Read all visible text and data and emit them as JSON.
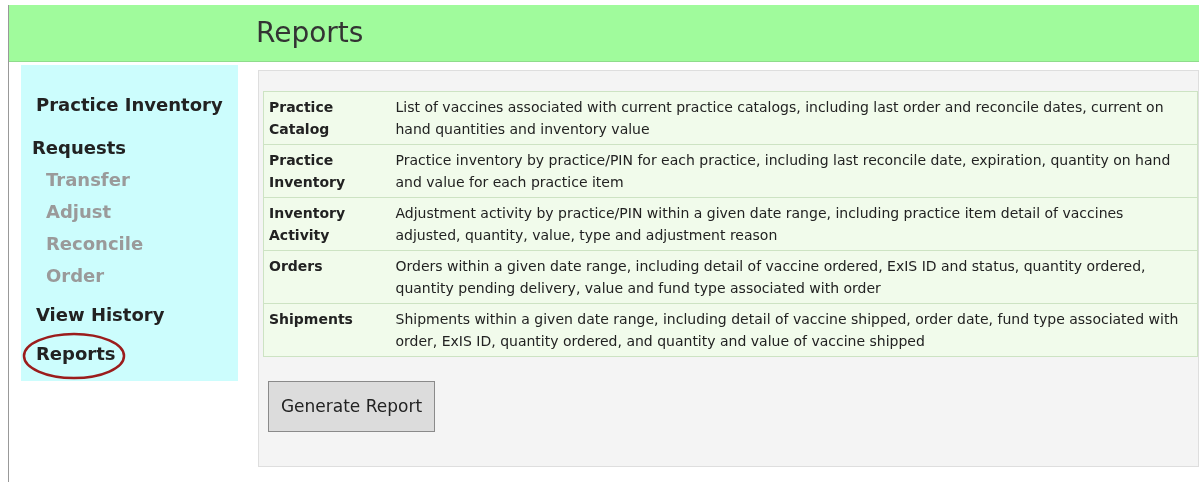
{
  "header": {
    "title": "Reports"
  },
  "sidebar": {
    "items": [
      {
        "label": "Practice Inventory",
        "kind": "link",
        "circled": false
      },
      {
        "label": "Requests",
        "kind": "heading",
        "circled": false
      },
      {
        "label": "Transfer",
        "kind": "sub",
        "circled": false
      },
      {
        "label": "Adjust",
        "kind": "sub",
        "circled": false
      },
      {
        "label": "Reconcile",
        "kind": "sub",
        "circled": false
      },
      {
        "label": "Order",
        "kind": "sub",
        "circled": false
      },
      {
        "label": "View History",
        "kind": "link",
        "circled": false
      },
      {
        "label": "Reports",
        "kind": "link",
        "circled": true
      }
    ]
  },
  "reports": [
    {
      "name": "Practice Catalog",
      "description": "List of vaccines associated with current practice catalogs, including last order and reconcile dates, current on hand quantities and inventory value"
    },
    {
      "name": "Practice Inventory",
      "description": "Practice inventory by practice/PIN for each practice, including last reconcile date, expiration, quantity on hand and value for each practice item"
    },
    {
      "name": "Inventory Activity",
      "description": "Adjustment activity by practice/PIN within a given date range, including practice item detail of vaccines adjusted, quantity, value, type and adjustment reason"
    },
    {
      "name": "Orders",
      "description": "Orders within a given date range, including detail of vaccine ordered, ExIS ID and status, quantity ordered, quantity pending delivery, value and fund type associated with order"
    },
    {
      "name": "Shipments",
      "description": "Shipments within a given date range, including detail of vaccine shipped, order date, fund type associated with order, ExIS ID, quantity ordered, and quantity and value of vaccine shipped"
    }
  ],
  "button": "Generate Report"
}
